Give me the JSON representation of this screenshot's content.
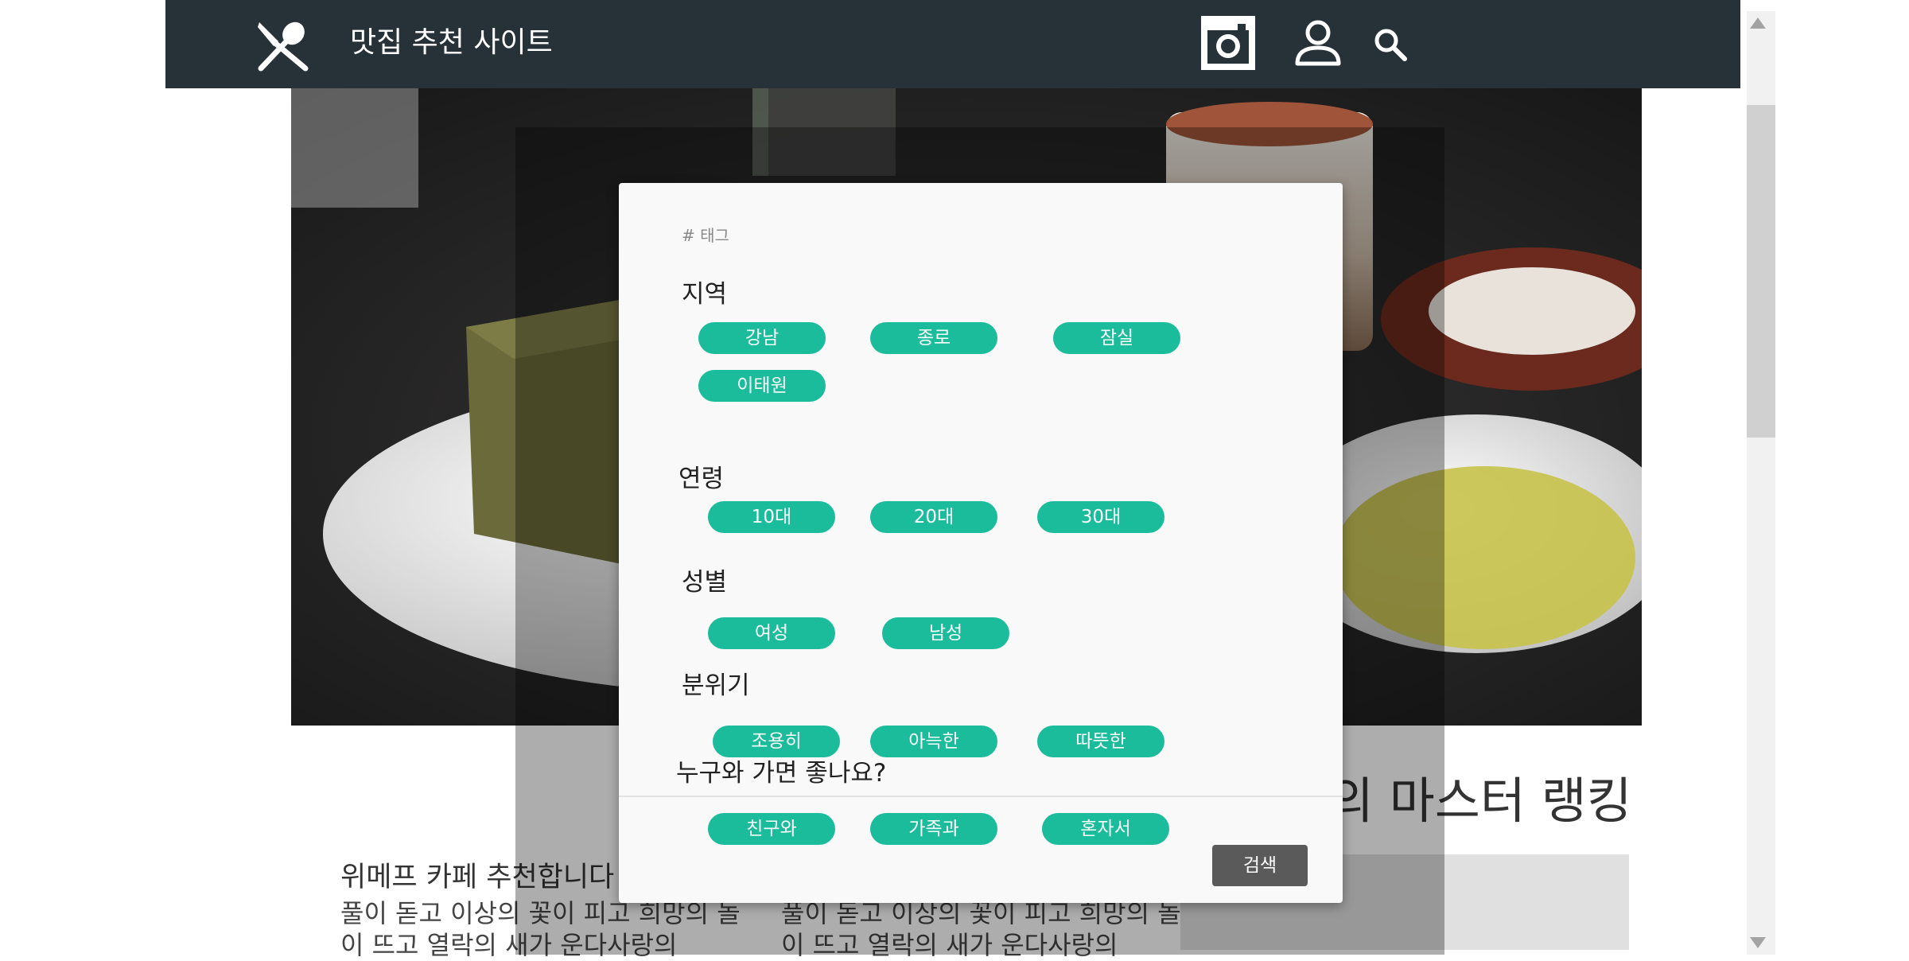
{
  "navbar": {
    "site_title": "맛집 추천 사이트",
    "icons": [
      "utensils-icon",
      "instagram-icon",
      "user-icon",
      "search-icon"
    ],
    "background": "#263238"
  },
  "page": {
    "ranking_title": "의 마스터 랭킹",
    "card1_title": "위메프 카페 추천합니다",
    "card_text": "풀이 돋고 이상의 꽃이 피고 희망의 놀이 뜨고 열락의 새가 운다사랑의"
  },
  "modal": {
    "tag_label": "# 태그",
    "sections": {
      "region": {
        "title": "지역",
        "chips": [
          "강남",
          "종로",
          "잠실",
          "이태원"
        ]
      },
      "age": {
        "title": "연령",
        "chips": [
          "10대",
          "20대",
          "30대"
        ]
      },
      "gender": {
        "title": "성별",
        "chips": [
          "여성",
          "남성"
        ]
      },
      "mood": {
        "title": "분위기",
        "chips": [
          "조용히",
          "아늑한",
          "따뜻한"
        ]
      },
      "companion": {
        "title": "누구와 가면 좋나요?",
        "chips": [
          "친구와",
          "가족과",
          "혼자서"
        ]
      }
    },
    "search_button": "검색",
    "chip_color": "#1abc9c",
    "button_color": "#5a5a5a"
  }
}
